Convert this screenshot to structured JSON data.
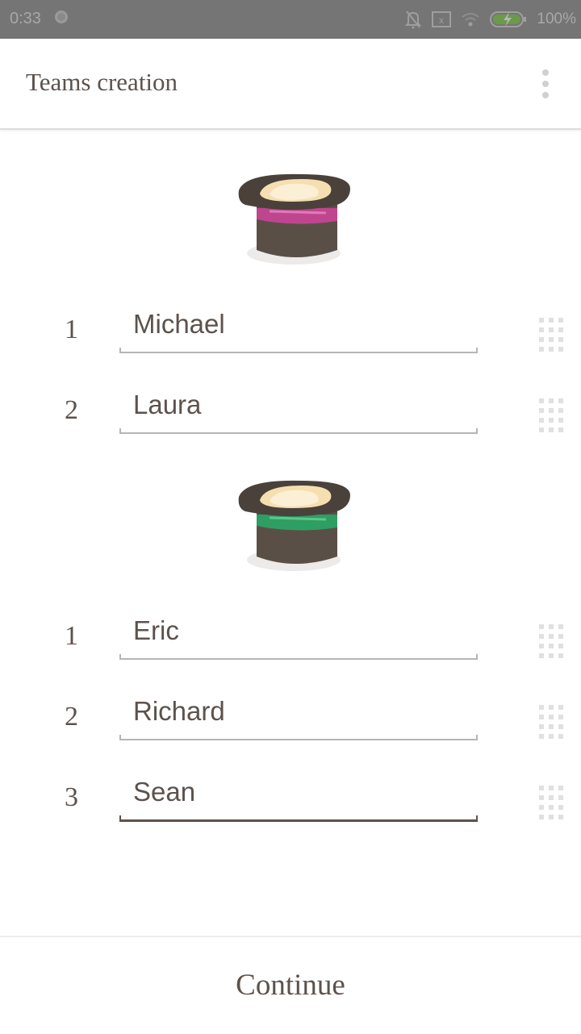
{
  "status_bar": {
    "time": "0:33",
    "battery_percent": "100%",
    "icons": [
      "circle-notification-icon",
      "bell-off-icon",
      "sim-error-icon",
      "wifi-icon",
      "battery-charging-icon"
    ]
  },
  "app_bar": {
    "title": "Teams creation",
    "overflow_icon": "more-vert-icon"
  },
  "teams": [
    {
      "hat_band_color": "#c0458f",
      "players": [
        {
          "number": "1",
          "name": "Michael"
        },
        {
          "number": "2",
          "name": "Laura"
        }
      ]
    },
    {
      "hat_band_color": "#2e9e62",
      "players": [
        {
          "number": "1",
          "name": "Eric"
        },
        {
          "number": "2",
          "name": "Richard"
        },
        {
          "number": "3",
          "name": "Sean"
        }
      ]
    }
  ],
  "footer": {
    "continue_label": "Continue"
  },
  "colors": {
    "text": "#5d524c",
    "status_bar": "#757575",
    "underline": "#b5b5b5",
    "underline_active": "#5d524c"
  }
}
